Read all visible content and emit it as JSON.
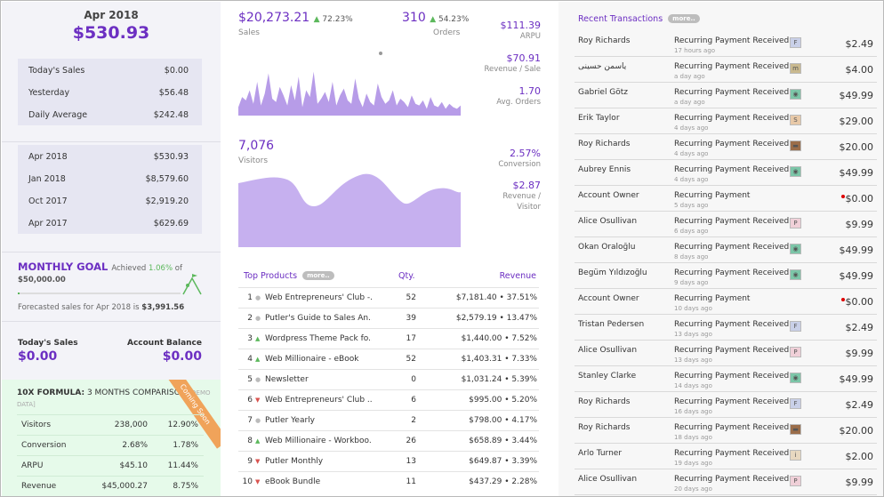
{
  "summary": {
    "month": "Apr 2018",
    "month_sales": "$530.93",
    "today_label": "Today's Sales",
    "today_value": "$0.00",
    "yesterday_label": "Yesterday",
    "yesterday_value": "$56.48",
    "daily_avg_label": "Daily Average",
    "daily_avg_value": "$242.48"
  },
  "periods": [
    {
      "label": "Apr 2018",
      "value": "$530.93"
    },
    {
      "label": "Jan 2018",
      "value": "$8,579.60"
    },
    {
      "label": "Oct 2017",
      "value": "$2,919.20"
    },
    {
      "label": "Apr 2017",
      "value": "$629.69"
    }
  ],
  "goal": {
    "title": "MONTHLY GOAL",
    "achieved_label": "Achieved",
    "achieved_pct": "1.06%",
    "achieved_of": "of",
    "amount": "$50,000.00",
    "progress": 0.0106,
    "forecast_text": "Forecasted sales for Apr 2018 is",
    "forecast_value": "$3,991.56"
  },
  "balances": {
    "today_label": "Today's Sales",
    "today_value": "$0.00",
    "account_label": "Account Balance",
    "account_value": "$0.00"
  },
  "formula": {
    "title_bold": "10X FORMULA:",
    "title_rest": "3 MONTHS COMPARISON",
    "demo": "[DEMO",
    "demo2": "DATA]",
    "ribbon": "Coming Soon",
    "rows": [
      {
        "label": "Visitors",
        "value": "238,000",
        "pct": "12.90%"
      },
      {
        "label": "Conversion",
        "value": "2.68%",
        "pct": "1.78%"
      },
      {
        "label": "ARPU",
        "value": "$45.10",
        "pct": "11.44%"
      },
      {
        "label": "Revenue",
        "value": "$45,000.27",
        "pct": "8.75%"
      }
    ]
  },
  "sales": {
    "value": "$20,273.21",
    "pct": "72.23%",
    "label": "Sales",
    "orders_value": "310",
    "orders_pct": "54.23%",
    "orders_label": "Orders",
    "arpu_value": "$111.39",
    "arpu_label": "ARPU",
    "rps_value": "$70.91",
    "rps_label": "Revenue / Sale",
    "avg_orders_value": "1.70",
    "avg_orders_label": "Avg. Orders",
    "chart_color": "#b79ce8"
  },
  "visitors": {
    "value": "7,076",
    "label": "Visitors",
    "conv_value": "2.57%",
    "conv_label": "Conversion",
    "rpv_value": "$2.87",
    "rpv_label1": "Revenue /",
    "rpv_label2": "Visitor",
    "chart_color": "#c6b0ef"
  },
  "top_products": {
    "title": "Top Products",
    "more": "more..",
    "qty_label": "Qty.",
    "rev_label": "Revenue",
    "rows": [
      {
        "n": "1",
        "trend": "neutral",
        "name": "Web Entrepreneurs' Club -...",
        "qty": "52",
        "rev": "$7,181.40 • 37.51%"
      },
      {
        "n": "2",
        "trend": "neutral",
        "name": "Putler's Guide to Sales An...",
        "qty": "39",
        "rev": "$2,579.19 • 13.47%"
      },
      {
        "n": "3",
        "trend": "up",
        "name": "Wordpress Theme Pack fo...",
        "qty": "17",
        "rev": "$1,440.00 • 7.52%"
      },
      {
        "n": "4",
        "trend": "up",
        "name": "Web Millionaire - eBook",
        "qty": "52",
        "rev": "$1,403.31 • 7.33%"
      },
      {
        "n": "5",
        "trend": "neutral",
        "name": "Newsletter",
        "qty": "0",
        "rev": "$1,031.24 • 5.39%"
      },
      {
        "n": "6",
        "trend": "down",
        "name": "Web Entrepreneurs' Club ...",
        "qty": "6",
        "rev": "$995.00 • 5.20%"
      },
      {
        "n": "7",
        "trend": "neutral",
        "name": "Putler Yearly",
        "qty": "2",
        "rev": "$798.00 • 4.17%"
      },
      {
        "n": "8",
        "trend": "up",
        "name": "Web Millionaire - Workboo...",
        "qty": "26",
        "rev": "$658.89 • 3.44%"
      },
      {
        "n": "9",
        "trend": "down",
        "name": "Putler Monthly",
        "qty": "13",
        "rev": "$649.87 • 3.39%"
      },
      {
        "n": "10",
        "trend": "down",
        "name": "eBook Bundle",
        "qty": "11",
        "rev": "$437.29 • 2.28%"
      }
    ]
  },
  "transactions": {
    "title": "Recent Transactions",
    "more": "more..",
    "rows": [
      {
        "who": "Roy Richards",
        "what": "Recurring Payment Received",
        "when": "17 hours ago",
        "logo": "F",
        "logo_color": "#c9d0e8",
        "amt": "$2.49",
        "flag": false
      },
      {
        "who": "یاسمن حسینی",
        "what": "Recurring Payment Received",
        "when": "a day ago",
        "logo": "m",
        "logo_color": "#c9b98f",
        "amt": "$4.00",
        "flag": false
      },
      {
        "who": "Gabriel Götz",
        "what": "Recurring Payment Received",
        "when": "a day ago",
        "logo": "◉",
        "logo_color": "#7cc6a8",
        "amt": "$49.99",
        "flag": false
      },
      {
        "who": "Erik Taylor",
        "what": "Recurring Payment Received",
        "when": "4 days ago",
        "logo": "S",
        "logo_color": "#e8c9a8",
        "amt": "$29.00",
        "flag": false
      },
      {
        "who": "Roy Richards",
        "what": "Recurring Payment Received",
        "when": "4 days ago",
        "logo": "▬",
        "logo_color": "#9b6e4a",
        "amt": "$20.00",
        "flag": false
      },
      {
        "who": "Aubrey Ennis",
        "what": "Recurring Payment Received",
        "when": "4 days ago",
        "logo": "◉",
        "logo_color": "#7cc6a8",
        "amt": "$49.99",
        "flag": false
      },
      {
        "who": "Account Owner",
        "what": "Recurring Payment",
        "when": "5 days ago",
        "logo": "",
        "logo_color": "",
        "amt": "$0.00",
        "flag": true
      },
      {
        "who": "Alice Osullivan",
        "what": "Recurring Payment Received",
        "when": "6 days ago",
        "logo": "P",
        "logo_color": "#f0d0d8",
        "amt": "$9.99",
        "flag": false
      },
      {
        "who": "Okan Oraloğlu",
        "what": "Recurring Payment Received",
        "when": "8 days ago",
        "logo": "◉",
        "logo_color": "#7cc6a8",
        "amt": "$49.99",
        "flag": false
      },
      {
        "who": "Begüm Yıldızoğlu",
        "what": "Recurring Payment Received",
        "when": "9 days ago",
        "logo": "◉",
        "logo_color": "#7cc6a8",
        "amt": "$49.99",
        "flag": false
      },
      {
        "who": "Account Owner",
        "what": "Recurring Payment",
        "when": "10 days ago",
        "logo": "",
        "logo_color": "",
        "amt": "$0.00",
        "flag": true
      },
      {
        "who": "Tristan Pedersen",
        "what": "Recurring Payment Received",
        "when": "13 days ago",
        "logo": "F",
        "logo_color": "#c9d0e8",
        "amt": "$2.49",
        "flag": false
      },
      {
        "who": "Alice Osullivan",
        "what": "Recurring Payment Received",
        "when": "13 days ago",
        "logo": "P",
        "logo_color": "#f0d0d8",
        "amt": "$9.99",
        "flag": false
      },
      {
        "who": "Stanley Clarke",
        "what": "Recurring Payment Received",
        "when": "14 days ago",
        "logo": "◉",
        "logo_color": "#7cc6a8",
        "amt": "$49.99",
        "flag": false
      },
      {
        "who": "Roy Richards",
        "what": "Recurring Payment Received",
        "when": "16 days ago",
        "logo": "F",
        "logo_color": "#c9d0e8",
        "amt": "$2.49",
        "flag": false
      },
      {
        "who": "Roy Richards",
        "what": "Recurring Payment Received",
        "when": "18 days ago",
        "logo": "▬",
        "logo_color": "#9b6e4a",
        "amt": "$20.00",
        "flag": false
      },
      {
        "who": "Arlo Turner",
        "what": "Recurring Payment Received",
        "when": "19 days ago",
        "logo": "i",
        "logo_color": "#e8d8c0",
        "amt": "$2.00",
        "flag": false
      },
      {
        "who": "Alice Osullivan",
        "what": "Recurring Payment Received",
        "when": "20 days ago",
        "logo": "P",
        "logo_color": "#f0d0d8",
        "amt": "$9.99",
        "flag": false
      }
    ]
  }
}
